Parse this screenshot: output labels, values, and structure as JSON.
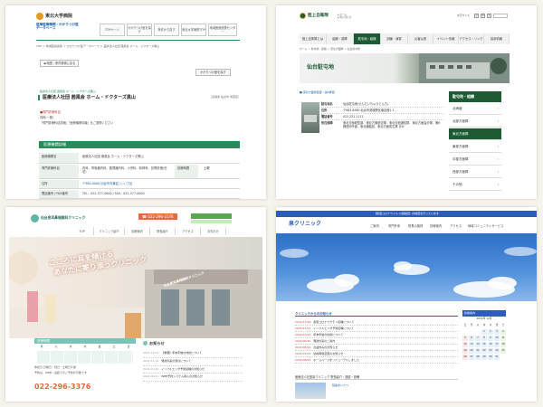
{
  "q1": {
    "logo_name": "東北大学病院",
    "db_line1": "医療医療機関・かかりつけ医",
    "db_line2": "データベース",
    "nav": [
      "TOPページ",
      "かかりつけ医を探す",
      "条件から探す",
      "東北大学病院TOP",
      "地域医療連携センター"
    ],
    "breadcrumb": "TOP ＞ 地域医療連携 ＞ かかりつけ医データベース ＞ 医療法人社団 茜風会 ホーム・ドクターズ黒山",
    "back_label": "◀ 地図・条件検索に戻る",
    "print_label": "かかりつけ医を探す",
    "org_small": "医療法人社団 茜風会 ホーム・ドクターズ黒山",
    "clinic_name": "医療法人社団 茜風会 ホーム・ドクターズ黒山",
    "area_tag": "［宮城県 仙台市 青葉区］",
    "dept_title": "■専門診療科目",
    "dept_line1": "内科(一般)",
    "dept_line2": "「専門診療科目詳細」「医療機関情報」をご参照ください",
    "section_title": "医療機関詳細",
    "rows": [
      {
        "k": "医療機関名",
        "v": "医療法人社団 茜風会 ホーム・ドクターズ黒山"
      },
      {
        "k": "専門診療科目",
        "v": "内科、呼吸器内科、循環器内科、小児科、精神科、訪問診療(在宅)"
      },
      {
        "k": "住所",
        "v": "〒980-0000 仙台市青葉区○○○丁目"
      },
      {
        "k": "電話番号 / FAX番号",
        "v": "TEL：022-377-0000 / FAX：022-377-0000"
      }
    ],
    "extra_k": "診療時間",
    "extra_v": "土曜"
  },
  "q2": {
    "logo_name": "陸上自衛隊",
    "top_links": [
      "文字サイズ",
      "小",
      "中",
      "大"
    ],
    "nav": [
      "陸上自衛隊とは",
      "組織・部隊",
      "駐屯地・組織",
      "訓練・演習",
      "災害派遣",
      "イベント情報",
      "アクセス・リンク",
      "採用情報"
    ],
    "breadcrumb": "ホーム ＞ 駐屯地・組織 ＞ 東北方面隊 ＞ 仙台駐屯地",
    "page_title": "仙台駐屯地",
    "link_caption": "■ 東北方面総監部・第6師団",
    "table": [
      {
        "k": "駐屯地名",
        "v": "仙台駐屯地(せんだいちゅうとんち)"
      },
      {
        "k": "住所",
        "v": "〒983-8580 仙台市宮城野区南目館1-1"
      },
      {
        "k": "電話番号",
        "v": "022-231-1111"
      },
      {
        "k": "所在部隊",
        "v": "東北方面総監部、東北方面航空隊、東北方面通信群、東北方面会計隊、第6師団司令部、東北補給処、東北方面衛生隊 ほか"
      }
    ],
    "side_title": "駐屯地・組織",
    "side_items": [
      "北海道",
      "北部方面隊",
      "東北方面隊",
      "東部方面隊",
      "中部方面隊",
      "西部方面隊",
      "その他"
    ]
  },
  "q3": {
    "clinic_name": "仙台泉耳鼻咽喉科クリニック",
    "phone": "☎ 022-296-3376",
    "tabs": [
      "TOP",
      "クリニック紹介",
      "診療案内",
      "院長紹介",
      "アクセス",
      "お知らせ"
    ],
    "hero_line1": "こころに耳を傾ける",
    "hero_line2": "あなたに寄り添うクリニック",
    "sign_text": "仙台泉耳鼻咽喉科クリニック",
    "hours_title": "診療時間",
    "hours_days": [
      "月",
      "火",
      "水",
      "木",
      "金",
      "土",
      "日"
    ],
    "hours_note": "休診日:日曜日・祝日・土曜日午後",
    "reserve_line": "予約は、WEB・電話でのご予約が可能です",
    "phone_big": "022-296-3376",
    "news_title": "お知らせ",
    "news": [
      {
        "date": "2021.12.01",
        "text": "【重要】年末年始の休診について"
      },
      {
        "date": "2021.11.15",
        "text": "発熱外来の受付について"
      },
      {
        "date": "2021.10.20",
        "text": "インフルエンザ予防接種のお知らせ"
      },
      {
        "date": "2021.09.01",
        "text": "WEB予約システム導入のお知らせ"
      }
    ]
  },
  "q4": {
    "banner": "【新型コロナウイルス感染症】の検査を行っています",
    "logo": "泉クリニック",
    "nav": [
      "ご案内",
      "専門外来",
      "院長の挨拶",
      "診療案内",
      "アクセス",
      "地域コミュニティサービス"
    ],
    "news_title": "クリニックからのお知らせ",
    "news": [
      {
        "date": "2021/11/30",
        "text": "新型コロナワクチン接種について"
      },
      {
        "date": "2021/11/01",
        "text": "インフルエンザ予防接種について"
      },
      {
        "date": "2021/10/15",
        "text": "年末年始の診療について"
      },
      {
        "date": "2021/09/20",
        "text": "発熱外来のご案内"
      },
      {
        "date": "2021/08/10",
        "text": "お盆休みのお知らせ"
      },
      {
        "date": "2021/07/01",
        "text": "診療時間変更のお知らせ"
      },
      {
        "date": "2021/06/01",
        "text": "ホームページをリニューアルしました"
      }
    ],
    "cal_title": "診療案内",
    "cal_month": "2021年 12月",
    "cal_days": [
      "日",
      "月",
      "火",
      "水",
      "木",
      "金",
      "土"
    ],
    "footer_title": "医療法人社団泉クリニック 院長紹介・施設・設備",
    "footer_text": "院長あいさつ"
  },
  "colors": {
    "green": "#2a8b5a",
    "dark_green": "#1c5b33",
    "blue": "#2e5db9",
    "orange": "#e6762a"
  }
}
